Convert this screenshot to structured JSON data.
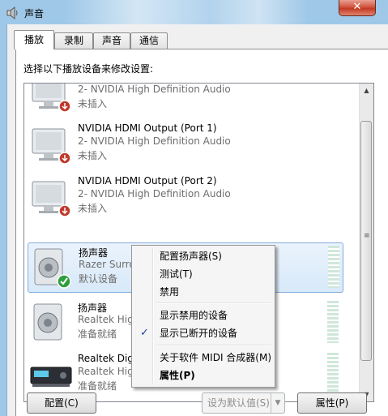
{
  "window": {
    "title": "声音",
    "close_glyph": "✕"
  },
  "tabs": [
    {
      "label": "播放",
      "active": true
    },
    {
      "label": "录制",
      "active": false
    },
    {
      "label": "声音",
      "active": false
    },
    {
      "label": "通信",
      "active": false
    }
  ],
  "instruction": "选择以下播放设备来修改设置:",
  "devices": [
    {
      "icon": "monitor-icon",
      "badge": "disconnected-badge-icon",
      "name": "",
      "sub": "2- NVIDIA High Definition Audio",
      "status": "未插入"
    },
    {
      "icon": "monitor-icon",
      "badge": "disconnected-badge-icon",
      "name": "NVIDIA HDMI Output (Port 1)",
      "sub": "2- NVIDIA High Definition Audio",
      "status": "未插入"
    },
    {
      "icon": "monitor-icon",
      "badge": "disconnected-badge-icon",
      "name": "NVIDIA HDMI Output (Port 2)",
      "sub": "2- NVIDIA High Definition Audio",
      "status": "未插入"
    },
    {
      "icon": "speaker-icon",
      "badge": "default-check-badge-icon",
      "name": "扬声器",
      "sub": "Razer Surround Audio Controller",
      "status": "默认设备",
      "selected": true
    },
    {
      "icon": "speaker-icon",
      "badge": "",
      "name": "扬声器",
      "sub": "Realtek High Definition Audio",
      "status": "准备就绪"
    },
    {
      "icon": "digital-output-icon",
      "badge": "",
      "name": "Realtek Digital Output",
      "sub": "Realtek High Definition Audio",
      "status": "准备就绪"
    }
  ],
  "context_menu": {
    "items": [
      {
        "label": "配置扬声器(S)"
      },
      {
        "label": "测试(T)"
      },
      {
        "label": "禁用"
      },
      {
        "label": "显示禁用的设备"
      },
      {
        "label": "显示已断开的设备",
        "checked": true,
        "check_glyph": "✓"
      },
      {
        "label": "关于软件 MIDI 合成器(M)"
      },
      {
        "label": "属性(P)",
        "bold": true
      }
    ]
  },
  "buttons": {
    "configure": "配置(C)",
    "set_default": "设为默认值(S)",
    "set_default_arrow": "▼",
    "properties": "属性(P)"
  },
  "scrollbar": {
    "up": "▲",
    "down": "▼",
    "grip": "≡"
  }
}
